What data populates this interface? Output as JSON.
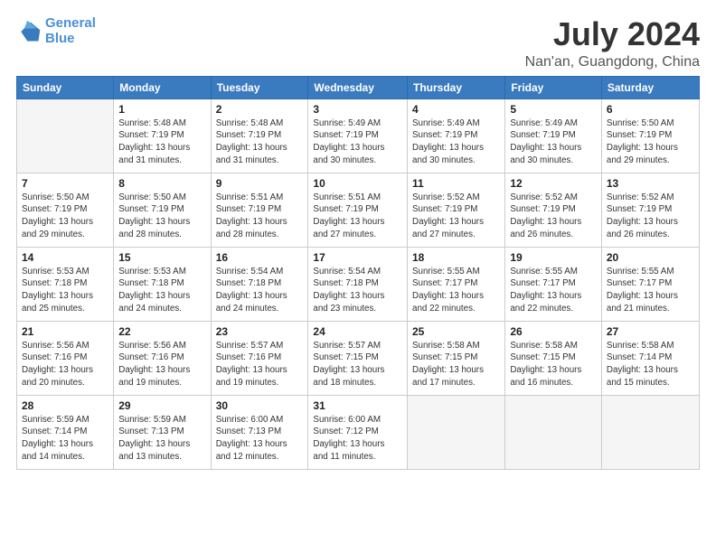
{
  "logo": {
    "line1": "General",
    "line2": "Blue"
  },
  "title": "July 2024",
  "subtitle": "Nan'an, Guangdong, China",
  "weekdays": [
    "Sunday",
    "Monday",
    "Tuesday",
    "Wednesday",
    "Thursday",
    "Friday",
    "Saturday"
  ],
  "weeks": [
    [
      {
        "day": "",
        "info": ""
      },
      {
        "day": "1",
        "info": "Sunrise: 5:48 AM\nSunset: 7:19 PM\nDaylight: 13 hours\nand 31 minutes."
      },
      {
        "day": "2",
        "info": "Sunrise: 5:48 AM\nSunset: 7:19 PM\nDaylight: 13 hours\nand 31 minutes."
      },
      {
        "day": "3",
        "info": "Sunrise: 5:49 AM\nSunset: 7:19 PM\nDaylight: 13 hours\nand 30 minutes."
      },
      {
        "day": "4",
        "info": "Sunrise: 5:49 AM\nSunset: 7:19 PM\nDaylight: 13 hours\nand 30 minutes."
      },
      {
        "day": "5",
        "info": "Sunrise: 5:49 AM\nSunset: 7:19 PM\nDaylight: 13 hours\nand 30 minutes."
      },
      {
        "day": "6",
        "info": "Sunrise: 5:50 AM\nSunset: 7:19 PM\nDaylight: 13 hours\nand 29 minutes."
      }
    ],
    [
      {
        "day": "7",
        "info": "Sunrise: 5:50 AM\nSunset: 7:19 PM\nDaylight: 13 hours\nand 29 minutes."
      },
      {
        "day": "8",
        "info": "Sunrise: 5:50 AM\nSunset: 7:19 PM\nDaylight: 13 hours\nand 28 minutes."
      },
      {
        "day": "9",
        "info": "Sunrise: 5:51 AM\nSunset: 7:19 PM\nDaylight: 13 hours\nand 28 minutes."
      },
      {
        "day": "10",
        "info": "Sunrise: 5:51 AM\nSunset: 7:19 PM\nDaylight: 13 hours\nand 27 minutes."
      },
      {
        "day": "11",
        "info": "Sunrise: 5:52 AM\nSunset: 7:19 PM\nDaylight: 13 hours\nand 27 minutes."
      },
      {
        "day": "12",
        "info": "Sunrise: 5:52 AM\nSunset: 7:19 PM\nDaylight: 13 hours\nand 26 minutes."
      },
      {
        "day": "13",
        "info": "Sunrise: 5:52 AM\nSunset: 7:19 PM\nDaylight: 13 hours\nand 26 minutes."
      }
    ],
    [
      {
        "day": "14",
        "info": "Sunrise: 5:53 AM\nSunset: 7:18 PM\nDaylight: 13 hours\nand 25 minutes."
      },
      {
        "day": "15",
        "info": "Sunrise: 5:53 AM\nSunset: 7:18 PM\nDaylight: 13 hours\nand 24 minutes."
      },
      {
        "day": "16",
        "info": "Sunrise: 5:54 AM\nSunset: 7:18 PM\nDaylight: 13 hours\nand 24 minutes."
      },
      {
        "day": "17",
        "info": "Sunrise: 5:54 AM\nSunset: 7:18 PM\nDaylight: 13 hours\nand 23 minutes."
      },
      {
        "day": "18",
        "info": "Sunrise: 5:55 AM\nSunset: 7:17 PM\nDaylight: 13 hours\nand 22 minutes."
      },
      {
        "day": "19",
        "info": "Sunrise: 5:55 AM\nSunset: 7:17 PM\nDaylight: 13 hours\nand 22 minutes."
      },
      {
        "day": "20",
        "info": "Sunrise: 5:55 AM\nSunset: 7:17 PM\nDaylight: 13 hours\nand 21 minutes."
      }
    ],
    [
      {
        "day": "21",
        "info": "Sunrise: 5:56 AM\nSunset: 7:16 PM\nDaylight: 13 hours\nand 20 minutes."
      },
      {
        "day": "22",
        "info": "Sunrise: 5:56 AM\nSunset: 7:16 PM\nDaylight: 13 hours\nand 19 minutes."
      },
      {
        "day": "23",
        "info": "Sunrise: 5:57 AM\nSunset: 7:16 PM\nDaylight: 13 hours\nand 19 minutes."
      },
      {
        "day": "24",
        "info": "Sunrise: 5:57 AM\nSunset: 7:15 PM\nDaylight: 13 hours\nand 18 minutes."
      },
      {
        "day": "25",
        "info": "Sunrise: 5:58 AM\nSunset: 7:15 PM\nDaylight: 13 hours\nand 17 minutes."
      },
      {
        "day": "26",
        "info": "Sunrise: 5:58 AM\nSunset: 7:15 PM\nDaylight: 13 hours\nand 16 minutes."
      },
      {
        "day": "27",
        "info": "Sunrise: 5:58 AM\nSunset: 7:14 PM\nDaylight: 13 hours\nand 15 minutes."
      }
    ],
    [
      {
        "day": "28",
        "info": "Sunrise: 5:59 AM\nSunset: 7:14 PM\nDaylight: 13 hours\nand 14 minutes."
      },
      {
        "day": "29",
        "info": "Sunrise: 5:59 AM\nSunset: 7:13 PM\nDaylight: 13 hours\nand 13 minutes."
      },
      {
        "day": "30",
        "info": "Sunrise: 6:00 AM\nSunset: 7:13 PM\nDaylight: 13 hours\nand 12 minutes."
      },
      {
        "day": "31",
        "info": "Sunrise: 6:00 AM\nSunset: 7:12 PM\nDaylight: 13 hours\nand 11 minutes."
      },
      {
        "day": "",
        "info": ""
      },
      {
        "day": "",
        "info": ""
      },
      {
        "day": "",
        "info": ""
      }
    ]
  ]
}
